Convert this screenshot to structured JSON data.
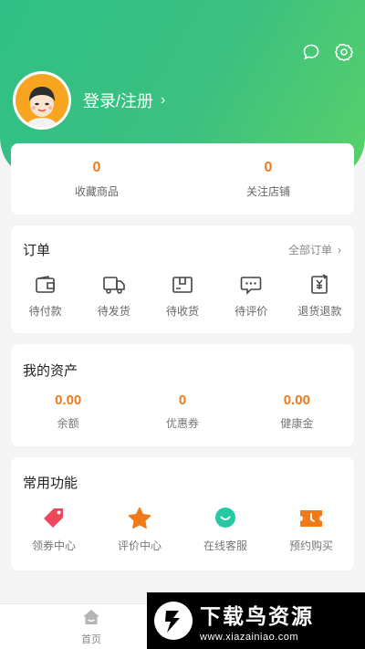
{
  "header": {
    "login_text": "登录/注册",
    "accent": "#3cc07f",
    "icons": [
      "chat-icon",
      "settings-icon"
    ]
  },
  "stats": [
    {
      "value": "0",
      "label": "收藏商品"
    },
    {
      "value": "0",
      "label": "关注店铺"
    }
  ],
  "orders": {
    "title": "订单",
    "all_label": "全部订单",
    "items": [
      {
        "label": "待付款",
        "icon": "wallet-icon"
      },
      {
        "label": "待发货",
        "icon": "truck-icon"
      },
      {
        "label": "待收货",
        "icon": "box-icon"
      },
      {
        "label": "待评价",
        "icon": "comment-icon"
      },
      {
        "label": "退货退款",
        "icon": "refund-icon"
      }
    ]
  },
  "assets": {
    "title": "我的资产",
    "items": [
      {
        "value": "0.00",
        "label": "余额"
      },
      {
        "value": "0",
        "label": "优惠券"
      },
      {
        "value": "0.00",
        "label": "健康金"
      }
    ]
  },
  "functions": {
    "title": "常用功能",
    "items": [
      {
        "label": "领券中心",
        "icon": "coupon-tag-icon",
        "color": "#f0455a"
      },
      {
        "label": "评价中心",
        "icon": "star-icon",
        "color": "#f07a1a"
      },
      {
        "label": "在线客服",
        "icon": "service-icon",
        "color": "#27c9a4"
      },
      {
        "label": "预约购买",
        "icon": "ticket-icon",
        "color": "#f07a1a"
      }
    ]
  },
  "tabbar": {
    "home_label": "首页"
  },
  "watermark": {
    "title": "下载鸟资源",
    "url": "www.xiazainiao.com"
  }
}
